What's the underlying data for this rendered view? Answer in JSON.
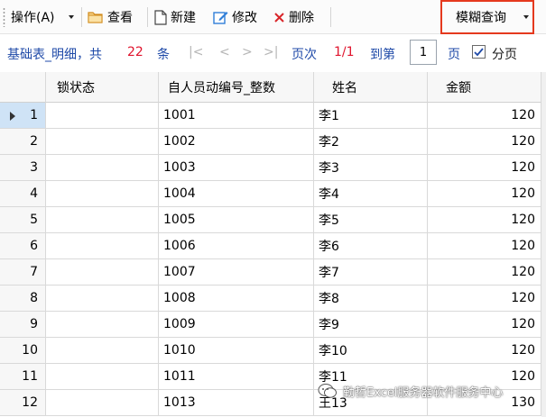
{
  "toolbar": {
    "operate_label": "操作(A)",
    "view_label": "查看",
    "new_label": "新建",
    "edit_label": "修改",
    "delete_label": "删除",
    "fuzzy_label": "模糊查询"
  },
  "pager": {
    "table_label": "基础表_明细，共",
    "total_count": "22",
    "unit": "条",
    "first": "|<",
    "prev": "<",
    "next": ">",
    "last": ">|",
    "page_label": "页次",
    "page_value": "1/1",
    "goto_label": "到第",
    "goto_value": "1",
    "goto_suffix": "页",
    "paginate_label": "分页",
    "paginate_checked": true
  },
  "table": {
    "columns": [
      "锁状态",
      "自人员动编号_整数",
      "姓名",
      "金额"
    ],
    "rows": [
      {
        "no": "1",
        "lock": "",
        "id": "1001",
        "name": "李1",
        "amount": "120"
      },
      {
        "no": "2",
        "lock": "",
        "id": "1002",
        "name": "李2",
        "amount": "120"
      },
      {
        "no": "3",
        "lock": "",
        "id": "1003",
        "name": "李3",
        "amount": "120"
      },
      {
        "no": "4",
        "lock": "",
        "id": "1004",
        "name": "李4",
        "amount": "120"
      },
      {
        "no": "5",
        "lock": "",
        "id": "1005",
        "name": "李5",
        "amount": "120"
      },
      {
        "no": "6",
        "lock": "",
        "id": "1006",
        "name": "李6",
        "amount": "120"
      },
      {
        "no": "7",
        "lock": "",
        "id": "1007",
        "name": "李7",
        "amount": "120"
      },
      {
        "no": "8",
        "lock": "",
        "id": "1008",
        "name": "李8",
        "amount": "120"
      },
      {
        "no": "9",
        "lock": "",
        "id": "1009",
        "name": "李9",
        "amount": "120"
      },
      {
        "no": "10",
        "lock": "",
        "id": "1010",
        "name": "李10",
        "amount": "120"
      },
      {
        "no": "11",
        "lock": "",
        "id": "1011",
        "name": "李11",
        "amount": "120"
      },
      {
        "no": "12",
        "lock": "",
        "id": "1013",
        "name": "王13",
        "amount": "130"
      }
    ]
  },
  "watermark": {
    "text": "勤哲Excel服务器软件服务中心"
  },
  "colors": {
    "link_blue": "#1f4aa8",
    "count_red": "#e0142d",
    "highlight_box": "#e5391e",
    "selected_row": "#cfe3f6"
  },
  "icons": {
    "view": "folder-icon",
    "new": "document-icon",
    "edit": "pencil-icon",
    "delete": "x-icon",
    "dropdown": "caret-down-icon",
    "row_pointer": "triangle-right-icon",
    "watermark": "wechat-icon"
  }
}
